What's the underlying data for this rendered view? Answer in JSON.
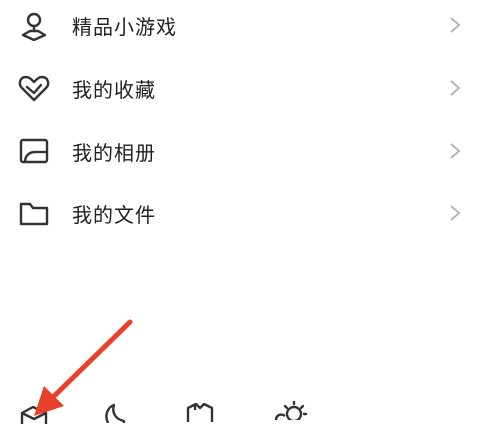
{
  "menu": {
    "items": [
      {
        "label": "精品小游戏",
        "icon": "game-pin-icon"
      },
      {
        "label": "我的收藏",
        "icon": "heart-favorite-icon"
      },
      {
        "label": "我的相册",
        "icon": "album-icon"
      },
      {
        "label": "我的文件",
        "icon": "folder-icon"
      }
    ]
  },
  "bottom_bar": {
    "icons": [
      "box-icon",
      "moon-icon",
      "shirt-icon",
      "weather-icon"
    ]
  },
  "colors": {
    "text": "#222222",
    "icon_stroke": "#333333",
    "chevron": "#b5b5b5",
    "arrow": "#e8402a"
  }
}
